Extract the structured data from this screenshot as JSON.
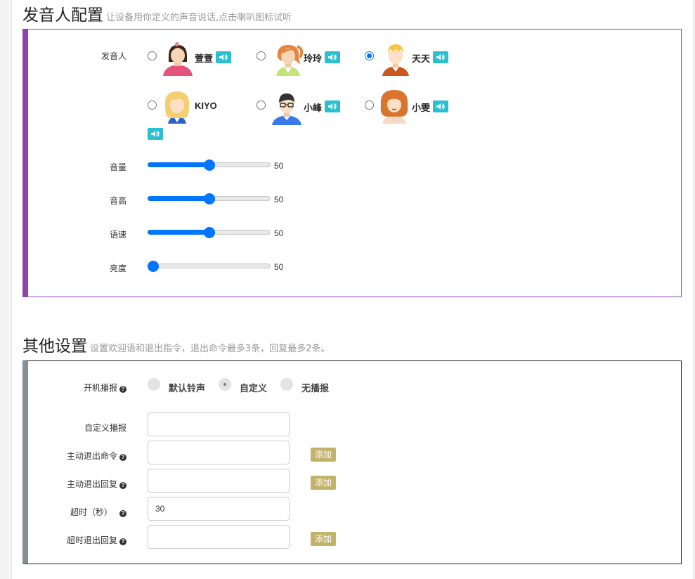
{
  "voice_section": {
    "title": "发音人配置",
    "subtitle": "让设备用你定义的声音说话,点击喇叭图标试听"
  },
  "voice_panel": {
    "voice_label": "发音人",
    "voices": [
      {
        "name": "萱萱",
        "selected": false,
        "icon": "girl-pink-avatar-icon"
      },
      {
        "name": "玲玲",
        "selected": false,
        "icon": "girl-ponytail-avatar-icon"
      },
      {
        "name": "天天",
        "selected": true,
        "icon": "boy-blond-avatar-icon"
      },
      {
        "name": "KIYO",
        "selected": false,
        "icon": "girl-blonde-avatar-icon"
      },
      {
        "name": "小峰",
        "selected": false,
        "icon": "boy-glasses-avatar-icon"
      },
      {
        "name": "小雯",
        "selected": false,
        "icon": "woman-curly-avatar-icon"
      }
    ],
    "sliders": [
      {
        "label": "音量",
        "value": 50,
        "fraction": 0.5
      },
      {
        "label": "音高",
        "value": 50,
        "fraction": 0.5
      },
      {
        "label": "语速",
        "value": 50,
        "fraction": 0.5
      },
      {
        "label": "亮度",
        "value": 50,
        "fraction": 0.0
      }
    ]
  },
  "other_section": {
    "title": "其他设置",
    "subtitle": "设置欢迎语和退出指令，退出命令最多3条，回复最多2条。"
  },
  "other_panel": {
    "boot_label": "开机播报",
    "boot_options": [
      {
        "label": "默认铃声",
        "selected": false
      },
      {
        "label": "自定义",
        "selected": true
      },
      {
        "label": "无播报",
        "selected": false
      }
    ],
    "custom_boot_label": "自定义播报",
    "custom_boot_value": "",
    "exit_cmd_label": "主动退出命令",
    "exit_cmd_value": "",
    "exit_reply_label": "主动退出回复",
    "exit_reply_value": "",
    "timeout_label": "超时（秒）",
    "timeout_value": "30",
    "timeout_reply_label": "超时退出回复",
    "timeout_reply_value": "",
    "add_label": "添加"
  },
  "colors": {
    "voice_accent": "#8e44ad",
    "other_accent": "#868e96",
    "speaker": "#2bc0d1",
    "add_button": "#c2b36b",
    "slider": "#0075ff"
  }
}
